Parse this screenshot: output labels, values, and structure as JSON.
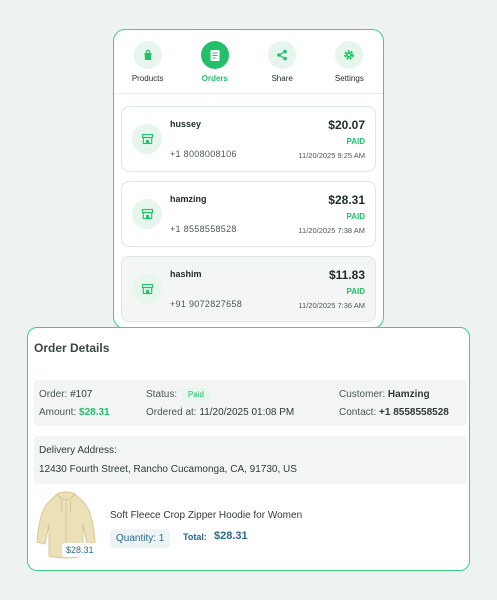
{
  "tabs": [
    {
      "label": "Products",
      "icon": "shopping-bag-icon",
      "active": false
    },
    {
      "label": "Orders",
      "icon": "receipt-icon",
      "active": true
    },
    {
      "label": "Share",
      "icon": "share-icon",
      "active": false
    },
    {
      "label": "Settings",
      "icon": "gear-icon",
      "active": false
    }
  ],
  "orders": [
    {
      "name": "hussey",
      "phone": "+1 8008008106",
      "amount": "$20.07",
      "status": "PAID",
      "time": "11/20/2025 9:25 AM"
    },
    {
      "name": "hamzing",
      "phone": "+1 8558558528",
      "amount": "$28.31",
      "status": "PAID",
      "time": "11/20/2025 7:38 AM"
    },
    {
      "name": "hashim",
      "phone": "+91 9072827658",
      "amount": "$11.83",
      "status": "PAID",
      "time": "11/20/2025 7:36 AM"
    }
  ],
  "details": {
    "title": "Order Details",
    "order_label": "Order:",
    "order_value": "#107",
    "amount_label": "Amount:",
    "amount_value": "$28.31",
    "status_label": "Status:",
    "status_value": "Paid",
    "ordered_label": "Ordered at:",
    "ordered_value": "11/20/2025 01:08 PM",
    "customer_label": "Customer:",
    "customer_value": "Hamzing",
    "contact_label": "Contact:",
    "contact_value": "+1 8558558528",
    "address_label": "Delivery Address:",
    "address_value": "12430 Fourth Street, Rancho Cucamonga, CA, 91730, US",
    "product": {
      "name": "Soft Fleece Crop Zipper Hoodie for Women",
      "price": "$28.31",
      "quantity": "Quantity: 1",
      "total_label": "Total:",
      "total_value": "$28.31"
    }
  },
  "colors": {
    "accent": "#22c06b",
    "border": "#3ecf86",
    "icon_bg": "#e6f6ec",
    "teal_text": "#2a6b8a"
  }
}
